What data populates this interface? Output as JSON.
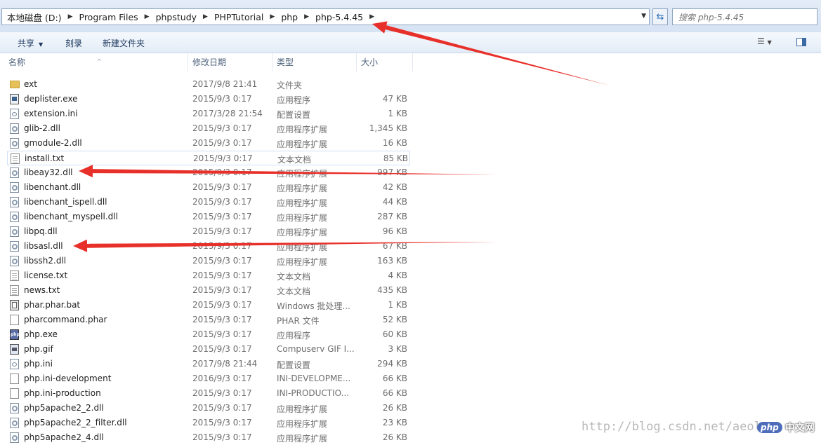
{
  "address_bar": {
    "breadcrumbs": [
      "本地磁盘 (D:)",
      "Program Files",
      "phpstudy",
      "PHPTutorial",
      "php",
      "php-5.4.45"
    ],
    "search_placeholder": "搜索 php-5.4.45"
  },
  "toolbar": {
    "share_label": "共享",
    "burn_label": "刻录",
    "new_folder_label": "新建文件夹"
  },
  "columns": {
    "name": "名称",
    "date": "修改日期",
    "type": "类型",
    "size": "大小"
  },
  "files": [
    {
      "name": "ext",
      "date": "2017/9/8 21:41",
      "type": "文件夹",
      "size": "",
      "icon": "folder"
    },
    {
      "name": "deplister.exe",
      "date": "2015/9/3 0:17",
      "type": "应用程序",
      "size": "47 KB",
      "icon": "exe"
    },
    {
      "name": "extension.ini",
      "date": "2017/3/28 21:54",
      "type": "配置设置",
      "size": "1 KB",
      "icon": "ini"
    },
    {
      "name": "glib-2.dll",
      "date": "2015/9/3 0:17",
      "type": "应用程序扩展",
      "size": "1,345 KB",
      "icon": "dll"
    },
    {
      "name": "gmodule-2.dll",
      "date": "2015/9/3 0:17",
      "type": "应用程序扩展",
      "size": "16 KB",
      "icon": "dll"
    },
    {
      "name": "install.txt",
      "date": "2015/9/3 0:17",
      "type": "文本文档",
      "size": "85 KB",
      "icon": "txt"
    },
    {
      "name": "libeay32.dll",
      "date": "2015/9/3 0:17",
      "type": "应用程序扩展",
      "size": "997 KB",
      "icon": "dll"
    },
    {
      "name": "libenchant.dll",
      "date": "2015/9/3 0:17",
      "type": "应用程序扩展",
      "size": "42 KB",
      "icon": "dll"
    },
    {
      "name": "libenchant_ispell.dll",
      "date": "2015/9/3 0:17",
      "type": "应用程序扩展",
      "size": "44 KB",
      "icon": "dll"
    },
    {
      "name": "libenchant_myspell.dll",
      "date": "2015/9/3 0:17",
      "type": "应用程序扩展",
      "size": "287 KB",
      "icon": "dll"
    },
    {
      "name": "libpq.dll",
      "date": "2015/9/3 0:17",
      "type": "应用程序扩展",
      "size": "96 KB",
      "icon": "dll"
    },
    {
      "name": "libsasl.dll",
      "date": "2015/9/3 0:17",
      "type": "应用程序扩展",
      "size": "67 KB",
      "icon": "dll"
    },
    {
      "name": "libssh2.dll",
      "date": "2015/9/3 0:17",
      "type": "应用程序扩展",
      "size": "163 KB",
      "icon": "dll"
    },
    {
      "name": "license.txt",
      "date": "2015/9/3 0:17",
      "type": "文本文档",
      "size": "4 KB",
      "icon": "txt"
    },
    {
      "name": "news.txt",
      "date": "2015/9/3 0:17",
      "type": "文本文档",
      "size": "435 KB",
      "icon": "txt"
    },
    {
      "name": "phar.phar.bat",
      "date": "2015/9/3 0:17",
      "type": "Windows 批处理...",
      "size": "1 KB",
      "icon": "bat"
    },
    {
      "name": "pharcommand.phar",
      "date": "2015/9/3 0:17",
      "type": "PHAR 文件",
      "size": "52 KB",
      "icon": "file"
    },
    {
      "name": "php.exe",
      "date": "2015/9/3 0:17",
      "type": "应用程序",
      "size": "60 KB",
      "icon": "php"
    },
    {
      "name": "php.gif",
      "date": "2015/9/3 0:17",
      "type": "Compuserv GIF I...",
      "size": "3 KB",
      "icon": "gif"
    },
    {
      "name": "php.ini",
      "date": "2017/9/8 21:44",
      "type": "配置设置",
      "size": "294 KB",
      "icon": "ini"
    },
    {
      "name": "php.ini-development",
      "date": "2016/9/3 0:17",
      "type": "INI-DEVELOPME...",
      "size": "66 KB",
      "icon": "file"
    },
    {
      "name": "php.ini-production",
      "date": "2015/9/3 0:17",
      "type": "INI-PRODUCTIO...",
      "size": "66 KB",
      "icon": "file"
    },
    {
      "name": "php5apache2_2.dll",
      "date": "2015/9/3 0:17",
      "type": "应用程序扩展",
      "size": "26 KB",
      "icon": "dll"
    },
    {
      "name": "php5apache2_2_filter.dll",
      "date": "2015/9/3 0:17",
      "type": "应用程序扩展",
      "size": "23 KB",
      "icon": "dll"
    },
    {
      "name": "php5apache2_4.dll",
      "date": "2015/9/3 0:17",
      "type": "应用程序扩展",
      "size": "26 KB",
      "icon": "dll"
    }
  ],
  "selected_index": 5,
  "watermark": "http://blog.csdn.net/aeol",
  "logo": {
    "mark": "php",
    "text": "中文网"
  },
  "annotation_color": "#e8302a"
}
